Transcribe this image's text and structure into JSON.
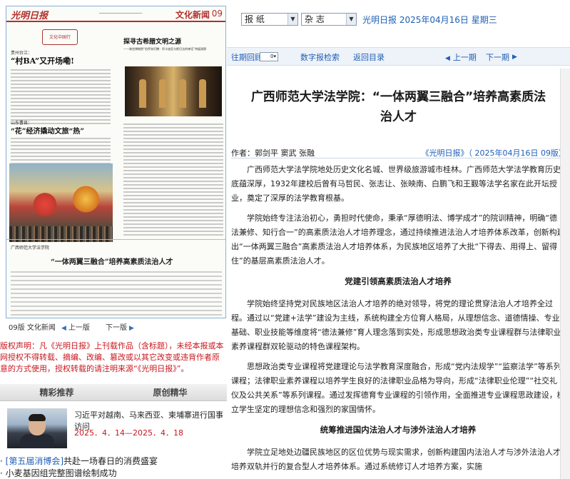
{
  "paper": {
    "logo": "光明日报",
    "section": "文化新闻",
    "page_no": "09",
    "left_kicker": "贵州台江：",
    "left_headline": "“村BA”又开场嘞!",
    "left_kicker2": "山东曹县：",
    "left_headline2": "“花”经济撬动文旅“热”",
    "right_headline": "探寻古希腊文明之源",
    "right_subline": "——故宫博物院“伯罗奔尼撒：阿卡迪亚与斯巴达的神话”特展观察",
    "bottom_box": "广西师范大学法学院",
    "bottom_headline": "“一体两翼三融合”培养高素质法治人才",
    "stamp_text": "文化中国行"
  },
  "page_nav": {
    "label": "09版 文化新闻",
    "prev": "上一版",
    "next": "下一版"
  },
  "copyright": "版权声明：凡《光明日报》上刊载作品（含标题），未经本报或本网授权不得转载、摘编、改编、篡改或以其它改变或违背作者原意的方式使用，授权转载的请注明来源“《光明日报》”。",
  "tabs": [
    "精彩推荐",
    "原创精华"
  ],
  "recommend": {
    "title": "习近平对越南、马来西亚、柬埔寨进行国事访问",
    "date": "2025．4．14—2025．4．18",
    "list": [
      {
        "tag": "[第五届消博会]",
        "text": "共赴一场春日的消费盛宴"
      },
      {
        "tag": "",
        "text": "小麦基因组完整图谱绘制成功"
      }
    ]
  },
  "toolbar": {
    "select1": "报 纸",
    "select2": "杂 志",
    "date": "光明日报  2025年04月16日  星期三"
  },
  "subbar": {
    "back": "往期回顾",
    "back_select": "0",
    "search": "数字报检索",
    "home": "返回目录",
    "prev": "上一期",
    "next": "下一期"
  },
  "article": {
    "title_line1": "广西师范大学法学院：“一体两翼三融合”培养高素质法",
    "title_line2": "治人才",
    "author": "作者：郭剑平  窦武  张融",
    "source": "《光明日报》（ 2025年04月16日   09版）",
    "p1": "广西师范大学法学院地处历史文化名城、世界级旅游城市桂林。广西师范大学法学教育历史底蕴深厚，1932年建校后曾有马哲民、张志让、张映南、白鹏飞和王觐等法学名家在此开坛授业，奠定了深厚的法学教育根基。",
    "p2": "学院始终专注法治初心，勇担时代使命，秉承“厚德明法、博学成才”的院训精神，明确“德法兼修、知行合一”的高素质法治人才培养理念，通过持续推进法治人才培养体系改革，创新构建出“一体两翼三融合”高素质法治人才培养体系，为民族地区培养了大批“下得去、用得上、留得住”的基层高素质法治人才。",
    "h1": "党建引领高素质法治人才培养",
    "p3": "学院始终坚持党对民族地区法治人才培养的绝对领导，将党的理论贯穿法治人才培养全过程。通过以“党建+法学”建设为主线，系统构建全方位育人格局，从理想信念、道德情操、专业基础、职业技能等维度将“德法兼修”育人理念落到实处，形成思想政治类专业课程群与法律职业素养课程群双轮驱动的特色课程架构。",
    "p4": "思想政治类专业课程将党建理论与法学教育深度融合，形成“党内法规学”“监察法学”等系列课程；法律职业素养课程以培养学生良好的法律职业品格为导向，形成“法律职业伦理”“社交礼仪及公共关系”等系列课程。通过发挥德育专业课程的引领作用，全面推进专业课程思政建设，树立学生坚定的理想信念和强烈的家国情怀。",
    "h2": "统筹推进国内法治人才与涉外法治人才培养",
    "p5": "学院立足地处边疆民族地区的区位优势与现实需求，创新构建国内法治人才与涉外法治人才培养双轨并行的复合型人才培养体系。通过系统修订人才培养方案，实施"
  }
}
